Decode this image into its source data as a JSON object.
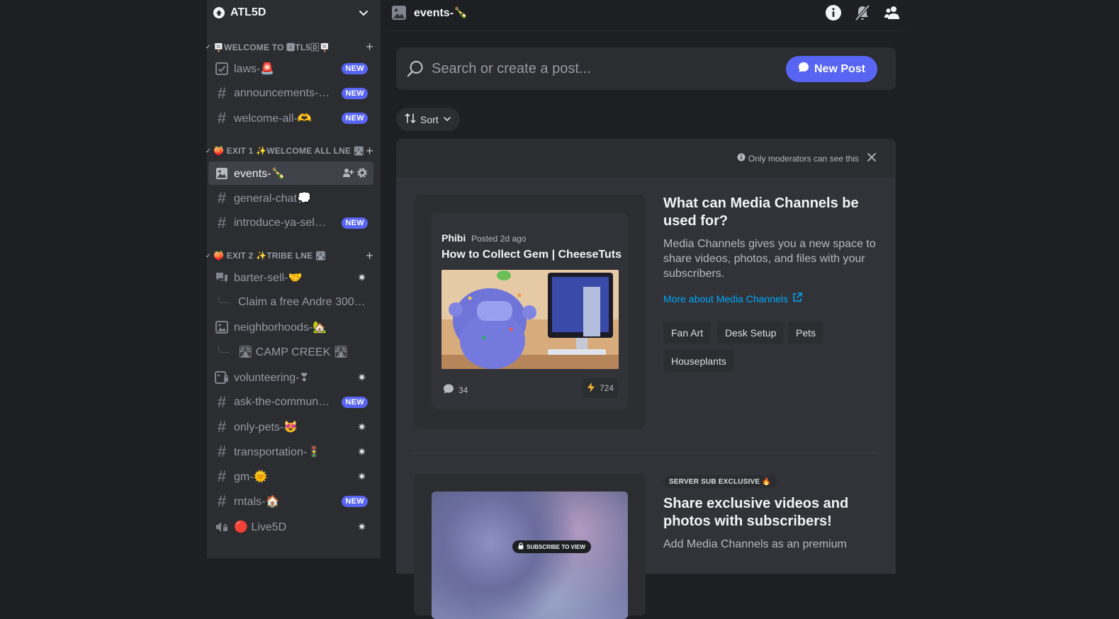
{
  "server": {
    "name": "ATL5D"
  },
  "topbar": {
    "channel_title": "events-🍾"
  },
  "sidebar": {
    "categories": [
      {
        "label": "🪧WELCOME TO 🅰TL5🄳🪧"
      },
      {
        "label": "🍑 EXIT 1 ✨WELCOME ALL LNE 🛣"
      },
      {
        "label": "🍑 EXIT 2 ✨TRIBE LNE 🛣"
      }
    ],
    "channels": [
      {
        "name": "laws-🚨",
        "badge": "NEW"
      },
      {
        "name": "announcements-…",
        "badge": "NEW"
      },
      {
        "name": "welcome-all-🫶",
        "badge": "NEW"
      },
      {
        "name": "events-🍾"
      },
      {
        "name": "general-chat💭"
      },
      {
        "name": "introduce-ya-sel…",
        "badge": "NEW"
      },
      {
        "name": "barter-sell-🤝"
      },
      {
        "name": "Claim a free Andre 300…"
      },
      {
        "name": "neighborhoods-🏡"
      },
      {
        "name": "🛣 CAMP CREEK 🛣"
      },
      {
        "name": "volunteering-❣"
      },
      {
        "name": "ask-the-commun…",
        "badge": "NEW"
      },
      {
        "name": "only-pets-😻"
      },
      {
        "name": "transportation-🚦"
      },
      {
        "name": "gm-🌞"
      },
      {
        "name": "rntals-🏠",
        "badge": "NEW"
      },
      {
        "name": "🔴 Live5D"
      }
    ]
  },
  "search": {
    "placeholder": "Search or create a post..."
  },
  "buttons": {
    "new_post": "New Post",
    "sort": "Sort"
  },
  "mod_note": "Only moderators can see this",
  "preview_post": {
    "author": "Phibi",
    "time": "Posted 2d ago",
    "title": "How to Collect Gem | CheeseTuts",
    "comments": "34",
    "reactions": "724"
  },
  "promo": {
    "title": "What can Media Channels be used for?",
    "description": "Media Channels gives you a new space to share videos, photos, and files with your subscribers.",
    "link": "More about Media Channels",
    "tags": [
      "Fan Art",
      "Desk Setup",
      "Pets",
      "Houseplants"
    ]
  },
  "exclusive": {
    "badge": "SERVER SUB EXCLUSIVE 🔥",
    "subscribe_label": "SUBSCRIBE TO VIEW",
    "title": "Share exclusive videos and photos with subscribers!",
    "description": "Add Media Channels as an premium"
  },
  "colors": {
    "accent": "#5865f2",
    "link": "#00a8fc",
    "sidebar_bg": "#2b2d31",
    "main_bg": "#1e1f22"
  }
}
